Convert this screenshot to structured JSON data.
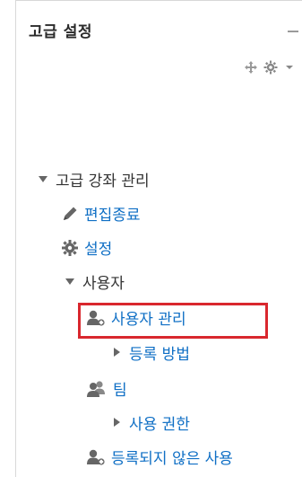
{
  "block": {
    "title": "고급 설정"
  },
  "colors": {
    "link": "#0f6fc5",
    "text": "#333333",
    "highlight": "#d9272e",
    "icon_gray": "#666666"
  },
  "tree": {
    "root_label": "고급 강좌 관리",
    "edit_label": "편집종료",
    "settings_label": "설정",
    "users_label": "사용자",
    "user_manage_label": "사용자 관리",
    "enrol_methods_label": "등록 방법",
    "team_label": "팀",
    "permissions_label": "사용 권한",
    "not_enrolled_label": "등록되지 않은 사용"
  }
}
